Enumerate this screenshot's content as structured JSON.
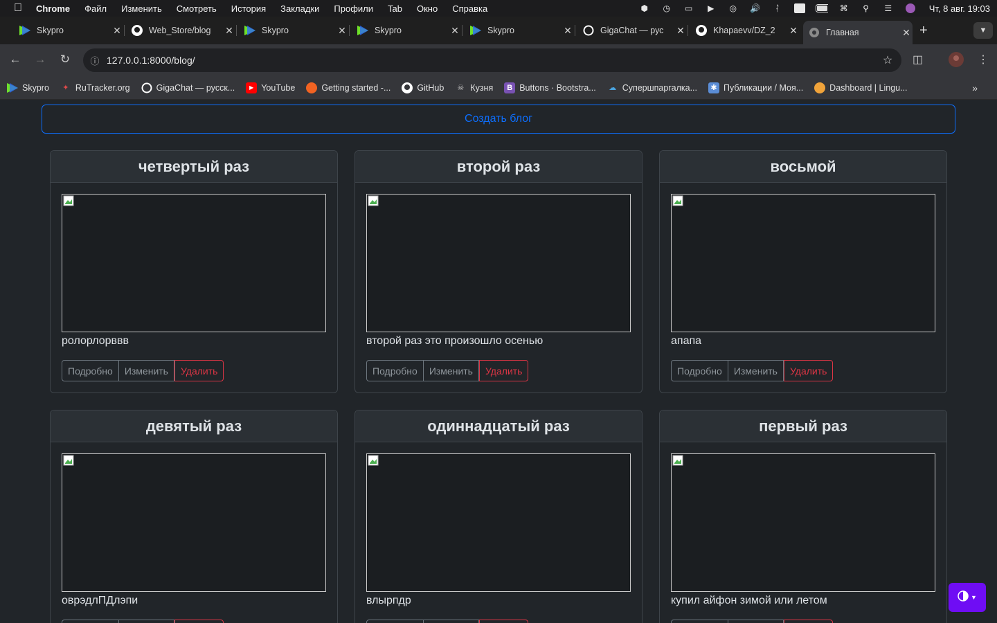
{
  "menubar": {
    "app_name": "Chrome",
    "items": [
      "Файл",
      "Изменить",
      "Смотреть",
      "История",
      "Закладки",
      "Профили",
      "Tab",
      "Окно",
      "Справка"
    ],
    "clock": "Чт, 8 авг.  19:03"
  },
  "tabs": [
    {
      "title": "Skypro",
      "icon": "skypro-icon"
    },
    {
      "title": "Web_Store/blog",
      "icon": "github-icon"
    },
    {
      "title": "Skypro",
      "icon": "skypro-icon"
    },
    {
      "title": "Skypro",
      "icon": "skypro-icon"
    },
    {
      "title": "Skypro",
      "icon": "skypro-icon"
    },
    {
      "title": "GigaChat — рус",
      "icon": "gigachat-icon"
    },
    {
      "title": "Khapaevv/DZ_2",
      "icon": "github-icon"
    },
    {
      "title": "Главная",
      "icon": "globe-icon"
    }
  ],
  "address_bar": {
    "url": "127.0.0.1:8000/blog/"
  },
  "bookmarks": [
    {
      "label": "Skypro",
      "icon": "skypro-icon"
    },
    {
      "label": "RuTracker.org",
      "icon": "rutracker-icon"
    },
    {
      "label": "GigaChat — русск...",
      "icon": "gigachat-icon"
    },
    {
      "label": "YouTube",
      "icon": "youtube-icon"
    },
    {
      "label": "Getting started -...",
      "icon": "getting-started-icon"
    },
    {
      "label": "GitHub",
      "icon": "github-icon"
    },
    {
      "label": "Кузня",
      "icon": "kuznya-icon"
    },
    {
      "label": "Buttons · Bootstra...",
      "icon": "bootstrap-icon"
    },
    {
      "label": "Супершпаргалка...",
      "icon": "cheatsheet-icon"
    },
    {
      "label": "Публикации / Моя...",
      "icon": "publications-icon"
    },
    {
      "label": "Dashboard | Lingu...",
      "icon": "lingualeo-icon"
    }
  ],
  "page": {
    "create_button": "Создать блог",
    "buttons": {
      "details": "Подробно",
      "edit": "Изменить",
      "delete": "Удалить"
    },
    "cards": [
      {
        "title": "четвертый раз",
        "text": "ролорлорввв"
      },
      {
        "title": "второй раз",
        "text": "второй раз это произошло осенью"
      },
      {
        "title": "восьмой",
        "text": "апапа"
      },
      {
        "title": "девятый раз",
        "text": "оврэдлПДлэпи"
      },
      {
        "title": "одиннадцатый раз",
        "text": "влырпдр"
      },
      {
        "title": "первый раз",
        "text": "купил айфон зимой или летом"
      }
    ]
  },
  "colors": {
    "primary": "#0d6efd",
    "danger": "#dc3545",
    "theme_toggle": "#6f0df4",
    "page_bg": "#212529"
  }
}
